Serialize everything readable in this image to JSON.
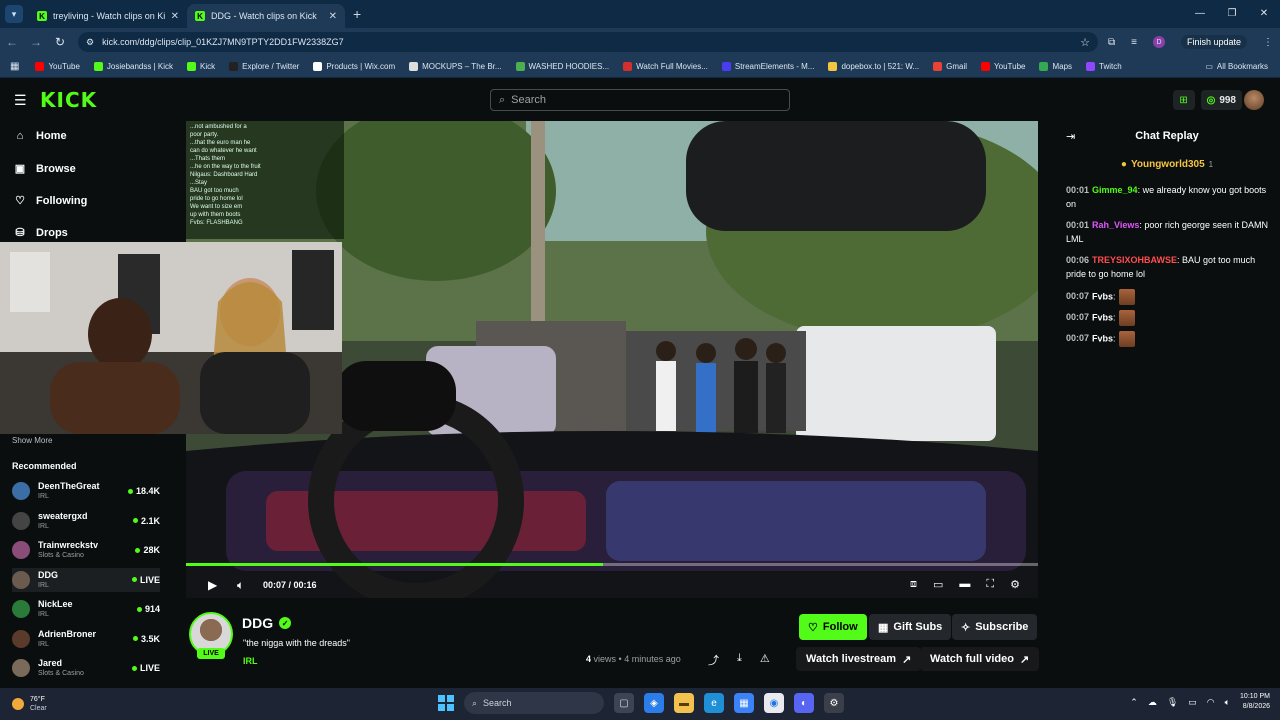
{
  "browser": {
    "tabs": [
      {
        "title": "treyliving - Watch clips on Kick",
        "active": false
      },
      {
        "title": "DDG - Watch clips on Kick",
        "active": true
      }
    ],
    "url": "kick.com/ddg/clips/clip_01KZJ7MN9TPTY2DD1FW2338ZG7",
    "finish_update": "Finish update",
    "bookmarks": [
      {
        "label": "YouTube",
        "color": "#ff0000"
      },
      {
        "label": "Josiebandss | Kick",
        "color": "#53fc18"
      },
      {
        "label": "Kick",
        "color": "#53fc18"
      },
      {
        "label": "Explore / Twitter",
        "color": "#222222"
      },
      {
        "label": "Products | Wix.com",
        "color": "#ffffff"
      },
      {
        "label": "MOCKUPS – The Br...",
        "color": "#dddddd"
      },
      {
        "label": "WASHED HOODIES...",
        "color": "#4caf50"
      },
      {
        "label": "Watch Full Movies...",
        "color": "#d32f2f"
      },
      {
        "label": "StreamElements - M...",
        "color": "#4b3cf0"
      },
      {
        "label": "dopebox.to | 521: W...",
        "color": "#f5c542"
      },
      {
        "label": "Gmail",
        "color": "#ea4335"
      },
      {
        "label": "YouTube",
        "color": "#ff0000"
      },
      {
        "label": "Maps",
        "color": "#34a853"
      },
      {
        "label": "Twitch",
        "color": "#9146ff"
      }
    ],
    "all_bookmarks": "All Bookmarks"
  },
  "header": {
    "logo": "KICK",
    "search_placeholder": "Search",
    "coins": "998"
  },
  "sidebar": {
    "nav": [
      {
        "label": "Home",
        "icon": "home-icon"
      },
      {
        "label": "Browse",
        "icon": "browse-icon"
      },
      {
        "label": "Following",
        "icon": "heart-icon"
      },
      {
        "label": "Drops",
        "icon": "drops-icon"
      }
    ],
    "show_more": "Show More",
    "recommended_title": "Recommended",
    "recommended": [
      {
        "name": "DeenTheGreat",
        "category": "IRL",
        "viewers": "18.4K",
        "avatar": "#3b6ea5"
      },
      {
        "name": "sweatergxd",
        "category": "IRL",
        "viewers": "2.1K",
        "avatar": "#444444"
      },
      {
        "name": "Trainwreckstv",
        "category": "Slots & Casino",
        "viewers": "28K",
        "avatar": "#8a4d7a"
      },
      {
        "name": "DDG",
        "category": "IRL",
        "viewers": "LIVE",
        "avatar": "#6b5b4e"
      },
      {
        "name": "NickLee",
        "category": "IRL",
        "viewers": "914",
        "avatar": "#2a7a3a"
      },
      {
        "name": "AdrienBroner",
        "category": "IRL",
        "viewers": "3.5K",
        "avatar": "#5a3a2a"
      },
      {
        "name": "Jared",
        "category": "Slots & Casino",
        "viewers": "LIVE",
        "avatar": "#7a6a5a"
      }
    ]
  },
  "player": {
    "current_time": "00:07",
    "duration": "00:16",
    "time_display": "00:07 / 00:16",
    "progress": 0.49
  },
  "overlay_chat": [
    "...not ambushed for a",
    "poor party.",
    "...that the euro man he",
    "can do whatever he want",
    "...Thats them",
    "...he on the way to the fruit",
    "Nilgaus: Dashboard Hard",
    "...Stay",
    "BAU got too much",
    "pride to go home lol",
    "We want to size em",
    "up with them boots",
    "Fvbs: FLASHBANG"
  ],
  "chat": {
    "title": "Chat Replay",
    "pinned_user": "Youngworld305",
    "pinned_count": "1",
    "messages": [
      {
        "time": "00:01",
        "user": "Gimme_94",
        "color": "#53fc18",
        "text": ": we already know you got boots on",
        "emote": false
      },
      {
        "time": "00:01",
        "user": "Rah_Views",
        "color": "#e056fd",
        "text": ": poor rich george seen it DAMN LML",
        "emote": false
      },
      {
        "time": "00:06",
        "user": "TREYSIXOHBAWSE",
        "color": "#ff4d4d",
        "text": ": BAU got too much pride to go home lol",
        "emote": false
      },
      {
        "time": "00:07",
        "user": "Fvbs",
        "color": "#ffffff",
        "text": ":",
        "emote": true
      },
      {
        "time": "00:07",
        "user": "Fvbs",
        "color": "#ffffff",
        "text": ":",
        "emote": true
      },
      {
        "time": "00:07",
        "user": "Fvbs",
        "color": "#ffffff",
        "text": ":",
        "emote": true
      }
    ]
  },
  "clip": {
    "channel": "DDG",
    "live_badge": "LIVE",
    "title": "\"the nigga with the dreads\"",
    "category": "IRL",
    "views_count": "4",
    "views_label": "views",
    "ago": "4 minutes ago",
    "follow": "Follow",
    "gift_subs": "Gift Subs",
    "subscribe": "Subscribe",
    "watch_livestream": "Watch livestream",
    "watch_full_video": "Watch full video"
  },
  "taskbar": {
    "temp": "76°F",
    "condition": "Clear",
    "search": "Search",
    "time": "10:10 PM",
    "date": "8/8/2026"
  }
}
